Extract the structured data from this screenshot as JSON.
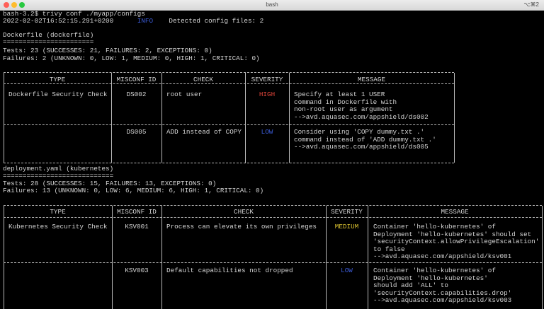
{
  "window": {
    "title": "bash",
    "shortcut": "⌥⌘2"
  },
  "terminal": {
    "prompt": "bash-3.2$ trivy conf ./myapp/configs",
    "log_timestamp": "2022-02-02T16:52:15.291+0200",
    "log_level": "INFO",
    "log_message": "Detected config files: 2",
    "sections": [
      {
        "header": "Dockerfile (dockerfile)",
        "underline": "=======================",
        "tests_line": "Tests: 23 (SUCCESSES: 21, FAILURES: 2, EXCEPTIONS: 0)",
        "failures_line": "Failures: 2 (UNKNOWN: 0, LOW: 1, MEDIUM: 0, HIGH: 1, CRITICAL: 0)",
        "table": {
          "columns": [
            "TYPE",
            "MISCONF ID",
            "CHECK",
            "SEVERITY",
            "MESSAGE"
          ],
          "type_label": "Dockerfile Security Check",
          "rows": [
            {
              "id": "DS002",
              "check": "root user",
              "severity": "HIGH",
              "message": [
                "Specify at least 1 USER",
                "command in Dockerfile with",
                "non-root user as argument",
                "-->avd.aquasec.com/appshield/ds002"
              ]
            },
            {
              "id": "DS005",
              "check": "ADD instead of COPY",
              "severity": "LOW",
              "message": [
                "Consider using 'COPY dummy.txt .'",
                "command instead of 'ADD dummy.txt .'",
                "-->avd.aquasec.com/appshield/ds005"
              ]
            }
          ]
        }
      },
      {
        "header": "deployment.yaml (kubernetes)",
        "underline": "============================",
        "tests_line": "Tests: 28 (SUCCESSES: 15, FAILURES: 13, EXCEPTIONS: 0)",
        "failures_line": "Failures: 13 (UNKNOWN: 0, LOW: 6, MEDIUM: 6, HIGH: 1, CRITICAL: 0)",
        "table": {
          "columns": [
            "TYPE",
            "MISCONF ID",
            "CHECK",
            "SEVERITY",
            "MESSAGE"
          ],
          "type_label": "Kubernetes Security Check",
          "rows": [
            {
              "id": "KSV001",
              "check": "Process can elevate its own privileges",
              "severity": "MEDIUM",
              "message": [
                "Container 'hello-kubernetes' of",
                "Deployment 'hello-kubernetes' should set",
                "'securityContext.allowPrivilegeEscalation'",
                "to false",
                "-->avd.aquasec.com/appshield/ksv001"
              ]
            },
            {
              "id": "KSV003",
              "check": "Default capabilities not dropped",
              "severity": "LOW",
              "message": [
                "Container 'hello-kubernetes' of",
                "Deployment 'hello-kubernetes'",
                "should add 'ALL' to",
                "'securityContext.capabilities.drop'",
                "-->avd.aquasec.com/appshield/ksv003"
              ]
            }
          ]
        }
      }
    ]
  }
}
